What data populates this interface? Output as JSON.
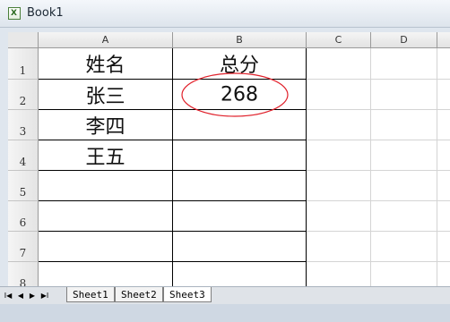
{
  "window": {
    "title": "Book1",
    "app_icon": "excel-icon"
  },
  "sheet": {
    "columns": [
      "A",
      "B",
      "C",
      "D"
    ],
    "rows": [
      "1",
      "2",
      "3",
      "4",
      "5",
      "6",
      "7",
      "8"
    ],
    "cells": {
      "A1": "姓名",
      "B1": "总分",
      "A2": "张三",
      "B2": "268",
      "A3": "李四",
      "A4": "王五"
    },
    "annotation": {
      "shape": "ellipse",
      "color": "#e0202a",
      "target": "B2"
    }
  },
  "tabs": {
    "nav": [
      "first-sheet-icon",
      "prev-sheet-icon",
      "next-sheet-icon",
      "last-sheet-icon"
    ],
    "items": [
      "Sheet1",
      "Sheet2",
      "Sheet3"
    ],
    "active": "Sheet3"
  }
}
